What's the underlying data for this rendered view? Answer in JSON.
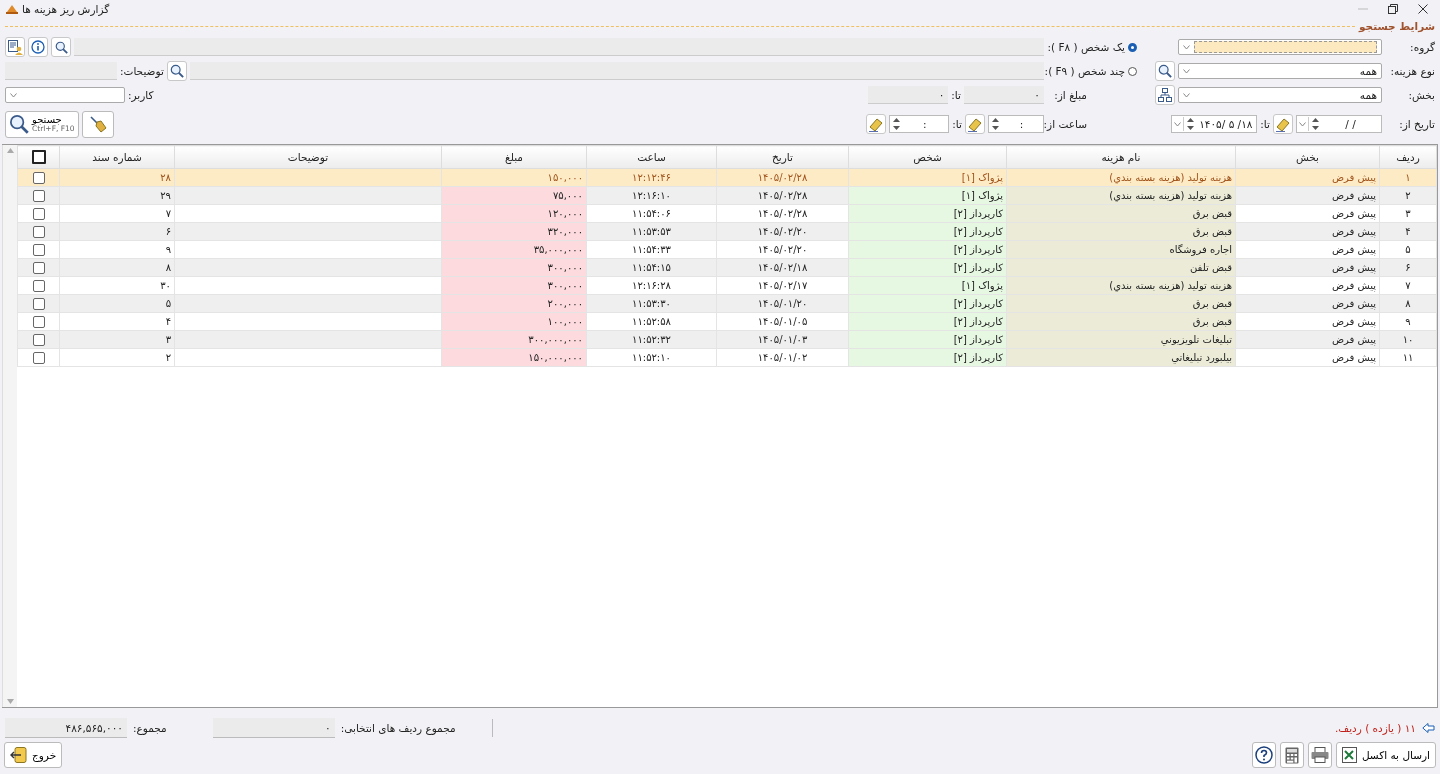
{
  "window": {
    "title": "گزارش ریز هزینه ها"
  },
  "search_section": {
    "title": "شرایط جستجو"
  },
  "filters": {
    "group": {
      "label": "گروه:"
    },
    "expense_type": {
      "label": "نوع هزینه:",
      "value": "همه"
    },
    "section": {
      "label": "بخش:",
      "value": "همه"
    },
    "date": {
      "label": "تاریخ از:",
      "from": "/  /",
      "to_label": "تا:",
      "to": "۱۴۰۵/ ۵ /۱۸"
    },
    "person_mode": [
      {
        "label": "یک شخص ( F۸ ):",
        "selected": true
      },
      {
        "label": "چند شخص ( F۹ ):",
        "selected": false
      }
    ],
    "amount": {
      "label": "مبلغ از:",
      "from": "۰",
      "to_label": "تا:",
      "to": "۰"
    },
    "time": {
      "label": "ساعت از:",
      "from": ":",
      "to_label": "تا:",
      "to": ":"
    },
    "description": {
      "label": "توضیحات:"
    },
    "user": {
      "label": "کاربر:"
    }
  },
  "search_button": {
    "label": "جستجو",
    "shortcut": "Ctrl+F, F10"
  },
  "table": {
    "columns": [
      "ردیف",
      "بخش",
      "نام هزینه",
      "شخص",
      "تاریخ",
      "ساعت",
      "مبلغ",
      "توضیحات",
      "شماره سند"
    ],
    "select_all_checked": false,
    "rows": [
      {
        "selected": true,
        "checked": false,
        "cells": [
          "۱",
          "پیش فرض",
          "هزینه تولید (هزینه بسته بندي)",
          "پژواک [۱]",
          "۱۴۰۵/۰۲/۲۸",
          "۱۲:۱۲:۴۶",
          "۱۵۰,۰۰۰",
          "",
          "۲۸"
        ]
      },
      {
        "selected": false,
        "checked": false,
        "cells": [
          "۲",
          "پیش فرض",
          "هزینه تولید (هزینه بسته بندي)",
          "پژواک [۱]",
          "۱۴۰۵/۰۲/۲۸",
          "۱۲:۱۶:۱۰",
          "۷۵,۰۰۰",
          "",
          "۲۹"
        ]
      },
      {
        "selected": false,
        "checked": false,
        "cells": [
          "۳",
          "پیش فرض",
          "قبض برق",
          "کارپرداز [۲]",
          "۱۴۰۵/۰۲/۲۸",
          "۱۱:۵۴:۰۶",
          "۱۲۰,۰۰۰",
          "",
          "۷"
        ]
      },
      {
        "selected": false,
        "checked": false,
        "cells": [
          "۴",
          "پیش فرض",
          "قبض برق",
          "کارپرداز [۲]",
          "۱۴۰۵/۰۲/۲۰",
          "۱۱:۵۳:۵۳",
          "۳۲۰,۰۰۰",
          "",
          "۶"
        ]
      },
      {
        "selected": false,
        "checked": false,
        "cells": [
          "۵",
          "پیش فرض",
          "اجاره فروشگاه",
          "کارپرداز [۲]",
          "۱۴۰۵/۰۲/۲۰",
          "۱۱:۵۴:۳۳",
          "۳۵,۰۰۰,۰۰۰",
          "",
          "۹"
        ]
      },
      {
        "selected": false,
        "checked": false,
        "cells": [
          "۶",
          "پیش فرض",
          "قبض تلفن",
          "کارپرداز [۲]",
          "۱۴۰۵/۰۲/۱۸",
          "۱۱:۵۴:۱۵",
          "۳۰۰,۰۰۰",
          "",
          "۸"
        ]
      },
      {
        "selected": false,
        "checked": false,
        "cells": [
          "۷",
          "پیش فرض",
          "هزینه تولید (هزینه بسته بندي)",
          "پژواک [۱]",
          "۱۴۰۵/۰۲/۱۷",
          "۱۲:۱۶:۲۸",
          "۳۰۰,۰۰۰",
          "",
          "۳۰"
        ]
      },
      {
        "selected": false,
        "checked": false,
        "cells": [
          "۸",
          "پیش فرض",
          "قبض برق",
          "کارپرداز [۲]",
          "۱۴۰۵/۰۱/۲۰",
          "۱۱:۵۳:۳۰",
          "۲۰۰,۰۰۰",
          "",
          "۵"
        ]
      },
      {
        "selected": false,
        "checked": false,
        "cells": [
          "۹",
          "پیش فرض",
          "قبض برق",
          "کارپرداز [۲]",
          "۱۴۰۵/۰۱/۰۵",
          "۱۱:۵۲:۵۸",
          "۱۰۰,۰۰۰",
          "",
          "۴"
        ]
      },
      {
        "selected": false,
        "checked": false,
        "cells": [
          "۱۰",
          "پیش فرض",
          "تبلیغات تلویزیوني",
          "کارپرداز [۲]",
          "۱۴۰۵/۰۱/۰۳",
          "۱۱:۵۲:۳۲",
          "۳۰۰,۰۰۰,۰۰۰",
          "",
          "۳"
        ]
      },
      {
        "selected": false,
        "checked": false,
        "cells": [
          "۱۱",
          "پیش فرض",
          "بیلبورد تبلیغاتي",
          "کارپرداز [۲]",
          "۱۴۰۵/۰۱/۰۲",
          "۱۱:۵۲:۱۰",
          "۱۵۰,۰۰۰,۰۰۰",
          "",
          "۲"
        ]
      }
    ]
  },
  "footer": {
    "row_count": "۱۱ ( یازده ) ردیف.",
    "selected_sum_label": "مجموع ردیف های انتخابی:",
    "selected_sum": "۰",
    "total_label": "مجموع:",
    "total": "۴۸۶,۵۶۵,۰۰۰"
  },
  "buttons": {
    "export": "ارسال به اکسل",
    "exit": "خروج"
  }
}
